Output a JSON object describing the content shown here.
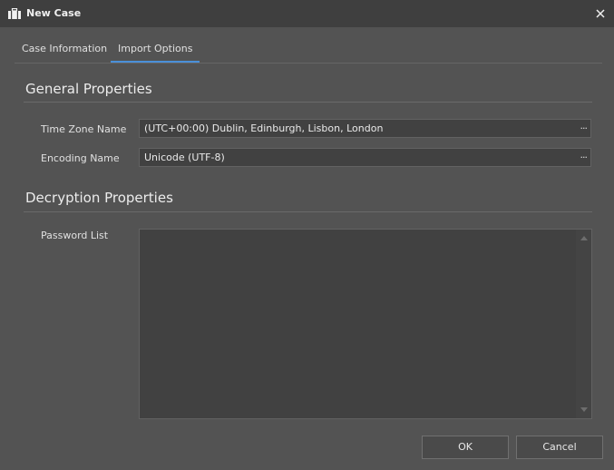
{
  "window": {
    "title": "New Case",
    "icon": "briefcase-icon",
    "close_icon": "close-icon"
  },
  "tabs": [
    {
      "label": "Case Information",
      "active": false
    },
    {
      "label": "Import Options",
      "active": true
    }
  ],
  "general": {
    "title": "General Properties",
    "time_zone_label": "Time Zone Name",
    "time_zone_value": "(UTC+00:00) Dublin, Edinburgh, Lisbon, London",
    "encoding_label": "Encoding Name",
    "encoding_value": "Unicode (UTF-8)",
    "ellipsis": "···"
  },
  "decryption": {
    "title": "Decryption Properties",
    "password_label": "Password List",
    "password_value": ""
  },
  "buttons": {
    "ok": "OK",
    "cancel": "Cancel"
  },
  "colors": {
    "background": "#535353",
    "titlebar": "#3f3f3f",
    "accent": "#4a90d9"
  }
}
